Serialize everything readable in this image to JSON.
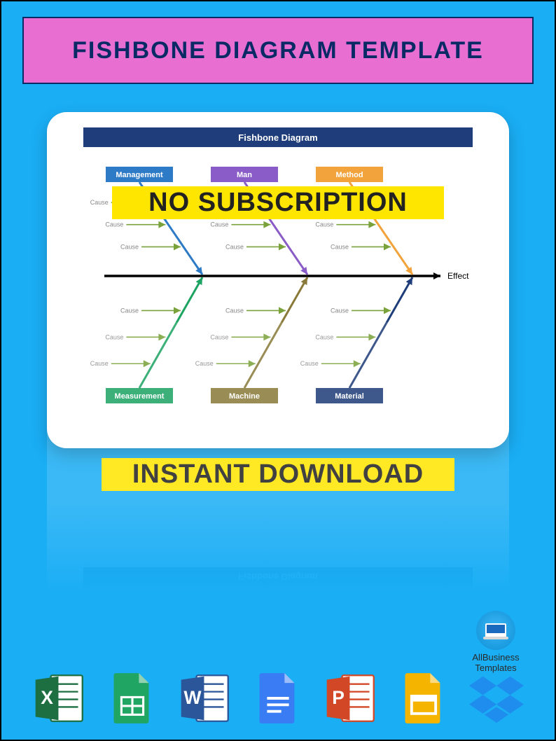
{
  "title": "FISHBONE DIAGRAM TEMPLATE",
  "overlay_top": "NO SUBSCRIPTION",
  "overlay_bottom": "INSTANT DOWNLOAD",
  "brand_line1": "AllBusiness",
  "brand_line2": "Templates",
  "fishbone": {
    "title": "Fishbone Diagram",
    "effect": "Effect",
    "cause": "Cause",
    "top_categories": [
      {
        "label": "Management",
        "color": "#2d7ac7"
      },
      {
        "label": "Man",
        "color": "#8a5cc7"
      },
      {
        "label": "Method",
        "color": "#f2a33c"
      }
    ],
    "bottom_categories": [
      {
        "label": "Measurement",
        "color": "#1da362"
      },
      {
        "label": "Machine",
        "color": "#8a7a3a"
      },
      {
        "label": "Material",
        "color": "#1f3d7a"
      }
    ]
  },
  "icons": [
    {
      "name": "excel-icon",
      "letter": "X",
      "color": "#1d6f42",
      "folded": true
    },
    {
      "name": "sheets-icon",
      "letter": "",
      "color": "#21a563",
      "style": "sheets"
    },
    {
      "name": "word-icon",
      "letter": "W",
      "color": "#2b579a",
      "folded": true
    },
    {
      "name": "docs-icon",
      "letter": "",
      "color": "#3a7cf4",
      "style": "docs"
    },
    {
      "name": "powerpoint-icon",
      "letter": "P",
      "color": "#d24726",
      "folded": true
    },
    {
      "name": "slides-icon",
      "letter": "",
      "color": "#f4b400",
      "style": "slides"
    },
    {
      "name": "dropbox-icon",
      "letter": "",
      "color": "#1f8ded",
      "style": "dropbox"
    }
  ]
}
